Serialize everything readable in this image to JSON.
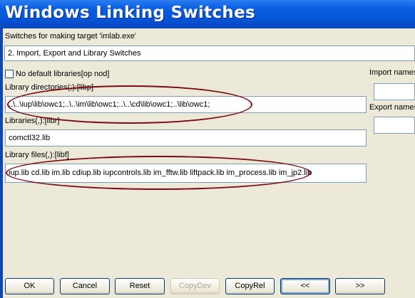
{
  "window": {
    "title": "Windows Linking Switches"
  },
  "target_label": "Switches for making target 'imlab.exe'",
  "category_select": {
    "value": "2. Import, Export and Library Switches"
  },
  "no_default_libraries": {
    "label": "No default libraries[op nod]",
    "checked": false
  },
  "library_directories": {
    "label": "Library directories(;):[libp]",
    "value": "..\\..\\iup\\lib\\owc1;..\\..\\im\\lib\\owc1;..\\..\\cd\\lib\\owc1;..\\lib\\owc1;"
  },
  "libraries": {
    "label": "Libraries(,):[libr]",
    "value": "comctl32.lib"
  },
  "library_files": {
    "label": "Library files(,):[libf]",
    "value": "iup.lib cd.lib im.lib cdiup.lib iupcontrols.lib im_fftw.lib liftpack.lib im_process.lib im_jp2.lib"
  },
  "import_names": {
    "label": "Import names"
  },
  "export_names": {
    "label": "Export names"
  },
  "buttons": {
    "ok": "OK",
    "cancel": "Cancel",
    "reset": "Reset",
    "copy_dev": "CopyDev",
    "copy_rel": "CopyRel",
    "prev": "<<",
    "next": ">>"
  },
  "colors": {
    "title_bar": "#0553d6",
    "annotation": "#7a0a14",
    "dialog_bg": "#ece9d8"
  }
}
